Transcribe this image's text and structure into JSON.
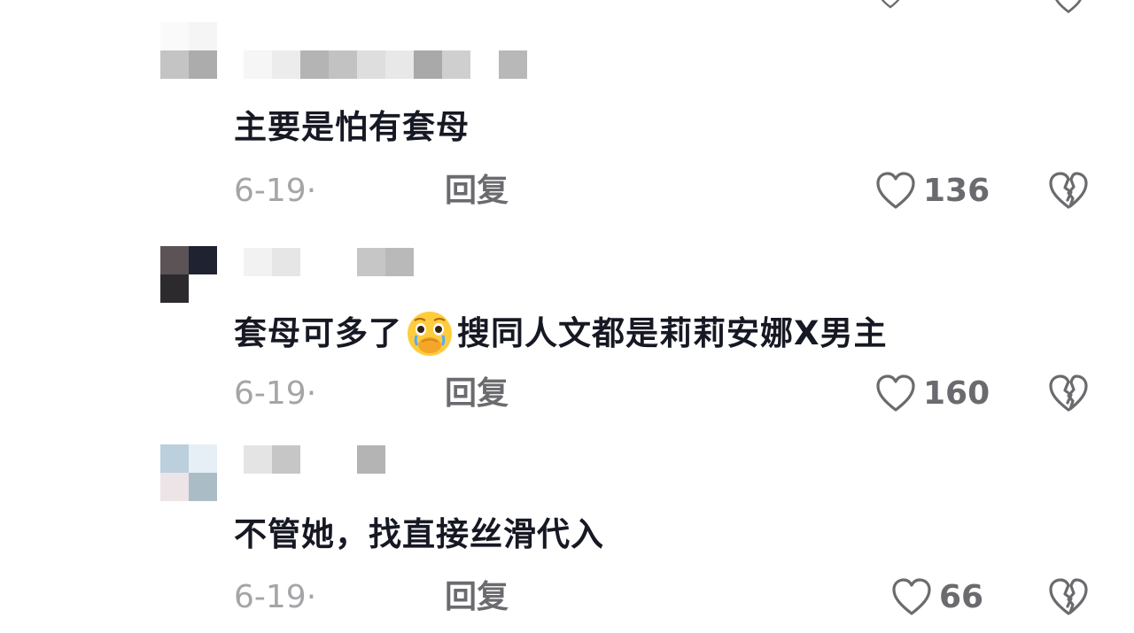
{
  "comments": [
    {
      "text": "主要是怕有套母",
      "date": "6-19·",
      "reply_label": "回复",
      "like_count": "136"
    },
    {
      "text_before_emoji": "套母可多了",
      "emoji": "crying-face-emoji",
      "text_after_emoji": "搜同人文都是莉莉安娜X男主",
      "date": "6-19·",
      "reply_label": "回复",
      "like_count": "160"
    },
    {
      "text": "不管她，找直接丝滑代入",
      "date": "6-19·",
      "reply_label": "回复",
      "like_count": "66"
    }
  ],
  "icons": {
    "like": "heart-outline-icon",
    "dislike": "broken-heart-icon"
  },
  "colors": {
    "text": "#161823",
    "meta": "#a5a5a8",
    "action": "#6b6b6f",
    "background": "#ffffff"
  }
}
